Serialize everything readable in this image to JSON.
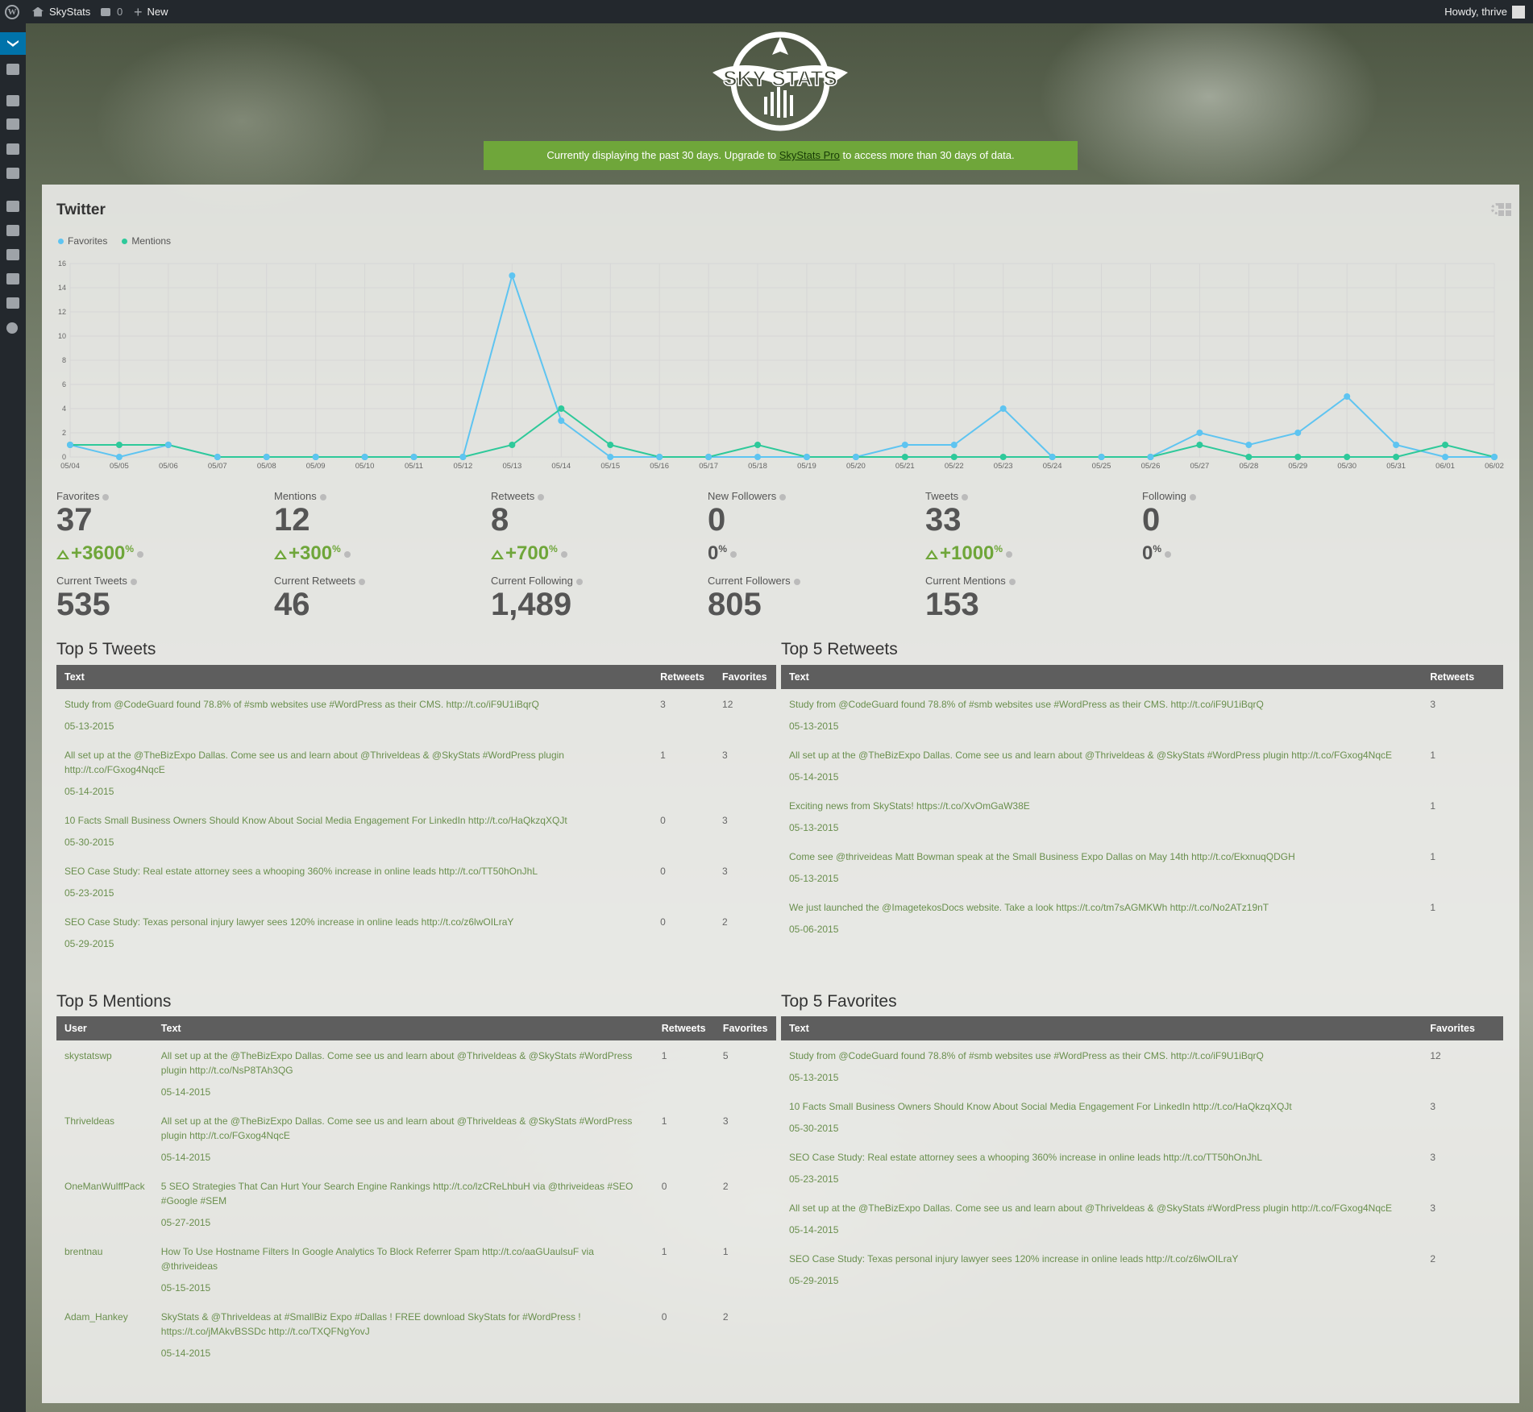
{
  "adminbar": {
    "site": "SkyStats",
    "comments": "0",
    "new": "New",
    "howdy": "Howdy, thrive"
  },
  "notice": {
    "before": "Currently displaying the past 30 days. Upgrade to ",
    "link": "SkyStats Pro",
    "after": " to access more than 30 days of data."
  },
  "logo": {
    "text": "SKY STATS"
  },
  "panel": {
    "title": "Twitter"
  },
  "colors": {
    "favorites": "#5ec4f1",
    "mentions": "#2ec99a",
    "accent_green": "#6fa63a",
    "table_header": "#5e5e5e"
  },
  "chart_data": {
    "type": "line",
    "x": [
      "05/04",
      "05/05",
      "05/06",
      "05/07",
      "05/08",
      "05/09",
      "05/10",
      "05/11",
      "05/12",
      "05/13",
      "05/14",
      "05/15",
      "05/16",
      "05/17",
      "05/18",
      "05/19",
      "05/20",
      "05/21",
      "05/22",
      "05/23",
      "05/24",
      "05/25",
      "05/26",
      "05/27",
      "05/28",
      "05/29",
      "05/30",
      "05/31",
      "06/01",
      "06/02"
    ],
    "series": [
      {
        "name": "Favorites",
        "values": [
          1,
          0,
          1,
          0,
          0,
          0,
          0,
          0,
          0,
          15,
          3,
          0,
          0,
          0,
          0,
          0,
          0,
          1,
          1,
          4,
          0,
          0,
          0,
          2,
          1,
          2,
          5,
          1,
          0,
          0
        ]
      },
      {
        "name": "Mentions",
        "values": [
          1,
          1,
          1,
          0,
          0,
          0,
          0,
          0,
          0,
          1,
          4,
          1,
          0,
          0,
          1,
          0,
          0,
          0,
          0,
          0,
          0,
          0,
          0,
          1,
          0,
          0,
          0,
          0,
          1,
          0
        ]
      }
    ],
    "ylim": [
      0,
      16
    ],
    "yticks": [
      0,
      2,
      4,
      6,
      8,
      10,
      12,
      14,
      16
    ],
    "legend": "top-left",
    "grid": true
  },
  "stats_row1": [
    {
      "label": "Favorites",
      "value": "37",
      "change": "+3600",
      "unit": "%",
      "up": true
    },
    {
      "label": "Mentions",
      "value": "12",
      "change": "+300",
      "unit": "%",
      "up": true
    },
    {
      "label": "Retweets",
      "value": "8",
      "change": "+700",
      "unit": "%",
      "up": true
    },
    {
      "label": "New Followers",
      "value": "0",
      "change": "0",
      "unit": "%",
      "up": false
    },
    {
      "label": "Tweets",
      "value": "33",
      "change": "+1000",
      "unit": "%",
      "up": true
    },
    {
      "label": "Following",
      "value": "0",
      "change": "0",
      "unit": "%",
      "up": false
    }
  ],
  "stats_row2": [
    {
      "label": "Current Tweets",
      "value": "535"
    },
    {
      "label": "Current Retweets",
      "value": "46"
    },
    {
      "label": "Current Following",
      "value": "1,489"
    },
    {
      "label": "Current Followers",
      "value": "805"
    },
    {
      "label": "Current Mentions",
      "value": "153"
    }
  ],
  "top_tweets": {
    "title": "Top 5 Tweets",
    "headers": [
      "Text",
      "Retweets",
      "Favorites"
    ],
    "rows": [
      {
        "text": "Study from @CodeGuard found 78.8% of #smb websites use #WordPress as their CMS. http://t.co/iF9U1iBqrQ",
        "date": "05-13-2015",
        "retweets": "3",
        "favorites": "12"
      },
      {
        "text": "All set up at the @TheBizExpo Dallas. Come see us and learn about @Thriveldeas & @SkyStats #WordPress plugin http://t.co/FGxog4NqcE",
        "date": "05-14-2015",
        "retweets": "1",
        "favorites": "3"
      },
      {
        "text": "10 Facts Small Business Owners Should Know About Social Media Engagement For LinkedIn http://t.co/HaQkzqXQJt",
        "date": "05-30-2015",
        "retweets": "0",
        "favorites": "3"
      },
      {
        "text": "SEO Case Study: Real estate attorney sees a whooping 360% increase in online leads http://t.co/TT50hOnJhL",
        "date": "05-23-2015",
        "retweets": "0",
        "favorites": "3"
      },
      {
        "text": "SEO Case Study: Texas personal injury lawyer sees 120% increase in online leads http://t.co/z6lwOILraY",
        "date": "05-29-2015",
        "retweets": "0",
        "favorites": "2"
      }
    ]
  },
  "top_retweets": {
    "title": "Top 5 Retweets",
    "headers": [
      "Text",
      "Retweets"
    ],
    "rows": [
      {
        "text": "Study from @CodeGuard found 78.8% of #smb websites use #WordPress as their CMS. http://t.co/iF9U1iBqrQ",
        "date": "05-13-2015",
        "retweets": "3"
      },
      {
        "text": "All set up at the @TheBizExpo Dallas. Come see us and learn about @Thriveldeas & @SkyStats #WordPress plugin http://t.co/FGxog4NqcE",
        "date": "05-14-2015",
        "retweets": "1"
      },
      {
        "text": "Exciting news from SkyStats! https://t.co/XvOmGaW38E",
        "date": "05-13-2015",
        "retweets": "1"
      },
      {
        "text": "Come see @thriveideas Matt Bowman speak at the Small Business Expo Dallas on May 14th http://t.co/EkxnuqQDGH",
        "date": "05-13-2015",
        "retweets": "1"
      },
      {
        "text": "We just launched the @ImagetekosDocs website. Take a look https://t.co/tm7sAGMKWh http://t.co/No2ATz19nT",
        "date": "05-06-2015",
        "retweets": "1"
      }
    ]
  },
  "top_mentions": {
    "title": "Top 5 Mentions",
    "headers": [
      "User",
      "Text",
      "Retweets",
      "Favorites"
    ],
    "rows": [
      {
        "user": "skystatswp",
        "text": "All set up at the @TheBizExpo Dallas. Come see us and learn about @Thriveldeas & @SkyStats #WordPress plugin http://t.co/NsP8TAh3QG",
        "date": "05-14-2015",
        "retweets": "1",
        "favorites": "5"
      },
      {
        "user": "Thriveldeas",
        "text": "All set up at the @TheBizExpo Dallas. Come see us and learn about @Thriveldeas & @SkyStats #WordPress plugin http://t.co/FGxog4NqcE",
        "date": "05-14-2015",
        "retweets": "1",
        "favorites": "3"
      },
      {
        "user": "OneManWulffPack",
        "text": "5 SEO Strategies That Can Hurt Your Search Engine Rankings http://t.co/lzCReLhbuH via @thriveideas #SEO #Google #SEM",
        "date": "05-27-2015",
        "retweets": "0",
        "favorites": "2"
      },
      {
        "user": "brentnau",
        "text": "How To Use Hostname Filters In Google Analytics To Block Referrer Spam http://t.co/aaGUaulsuF via @thriveideas",
        "date": "05-15-2015",
        "retweets": "1",
        "favorites": "1"
      },
      {
        "user": "Adam_Hankey",
        "text": "SkyStats & @Thriveldeas at #SmallBiz Expo #Dallas ! FREE download SkyStats for #WordPress ! https://t.co/jMAkvBSSDc http://t.co/TXQFNgYovJ",
        "date": "05-14-2015",
        "retweets": "0",
        "favorites": "2"
      }
    ]
  },
  "top_favorites": {
    "title": "Top 5 Favorites",
    "headers": [
      "Text",
      "Favorites"
    ],
    "rows": [
      {
        "text": "Study from @CodeGuard found 78.8% of #smb websites use #WordPress as their CMS. http://t.co/iF9U1iBqrQ",
        "date": "05-13-2015",
        "favorites": "12"
      },
      {
        "text": "10 Facts Small Business Owners Should Know About Social Media Engagement For LinkedIn http://t.co/HaQkzqXQJt",
        "date": "05-30-2015",
        "favorites": "3"
      },
      {
        "text": "SEO Case Study: Real estate attorney sees a whooping 360% increase in online leads http://t.co/TT50hOnJhL",
        "date": "05-23-2015",
        "favorites": "3"
      },
      {
        "text": "All set up at the @TheBizExpo Dallas. Come see us and learn about @Thriveldeas & @SkyStats #WordPress plugin http://t.co/FGxog4NqcE",
        "date": "05-14-2015",
        "favorites": "3"
      },
      {
        "text": "SEO Case Study: Texas personal injury lawyer sees 120% increase in online leads http://t.co/z6lwOILraY",
        "date": "05-29-2015",
        "favorites": "2"
      }
    ]
  }
}
